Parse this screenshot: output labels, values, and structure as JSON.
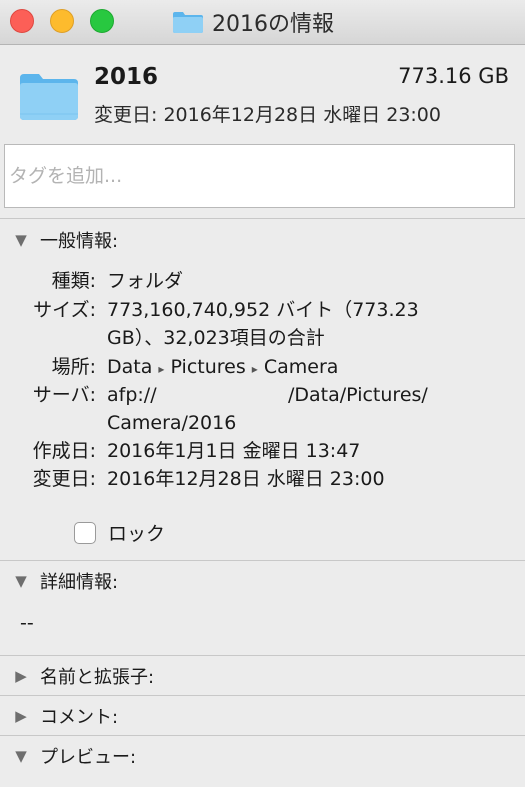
{
  "window": {
    "title": "2016の情報"
  },
  "header": {
    "name": "2016",
    "size": "773.16 GB",
    "modified": "変更日: 2016年12月28日 水曜日 23:00"
  },
  "tags": {
    "placeholder": "タグを追加..."
  },
  "general": {
    "heading": "一般情報:",
    "rows": {
      "kind": {
        "label": "種類:",
        "value": "フォルダ"
      },
      "size": {
        "label": "サイズ:",
        "line1": "773,160,740,952 バイト（773.23",
        "line2": "GB）、32,023項目の合計"
      },
      "where": {
        "label": "場所:",
        "part1": "Data",
        "part2": "Pictures",
        "part3": "Camera",
        "sep": "▸"
      },
      "server": {
        "label": "サーバ:",
        "part1": "afp://",
        "part2": "/Data/Pictures/",
        "line2": "Camera/2016"
      },
      "created": {
        "label": "作成日:",
        "value": "2016年1月1日 金曜日 13:47"
      },
      "modified": {
        "label": "変更日:",
        "value": "2016年12月28日 水曜日 23:00"
      }
    },
    "lock_label": "ロック"
  },
  "more_info": {
    "heading": "詳細情報:",
    "value": "--"
  },
  "name_ext": {
    "heading": "名前と拡張子:"
  },
  "comments": {
    "heading": "コメント:"
  },
  "preview": {
    "heading": "プレビュー:"
  },
  "icons": {
    "expanded": "▼",
    "collapsed": "▶"
  },
  "colors": {
    "folder_light": "#8fd0f5",
    "folder_dark": "#5cb5ec"
  }
}
